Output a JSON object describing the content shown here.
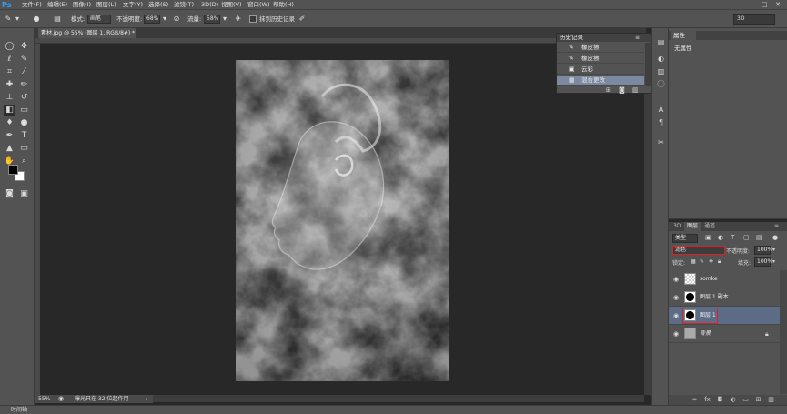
{
  "app": {
    "logo": "Ps"
  },
  "menu": [
    "文件(F)",
    "编辑(E)",
    "图像(I)",
    "图层(L)",
    "文字(Y)",
    "选择(S)",
    "滤镜(T)",
    "3D(D)",
    "视图(V)",
    "窗口(W)",
    "帮助(H)"
  ],
  "options": {
    "mode_label": "模式:",
    "mode_value": "画笔",
    "opacity_label": "不透明度:",
    "opacity_value": "68%",
    "flow_label": "流量:",
    "flow_value": "58%",
    "erase_history_label": "抹到历史记录",
    "workspace": "3D"
  },
  "document": {
    "tab_title": "素材.jpg @ 55% (图层 1, RGB/8#) *",
    "zoom": "55%",
    "status": "曝光只在 32 位起作用"
  },
  "timeline": {
    "label": "时间轴"
  },
  "history": {
    "title": "历史记录",
    "items": [
      {
        "label": "橡皮擦",
        "icon": "eraser-icon",
        "selected": false
      },
      {
        "label": "橡皮擦",
        "icon": "eraser-icon",
        "selected": false
      },
      {
        "label": "云彩",
        "icon": "filter-icon",
        "selected": false
      },
      {
        "label": "混合更改",
        "icon": "layers-icon",
        "selected": true
      }
    ]
  },
  "properties": {
    "title": "属性",
    "empty_text": "无属性"
  },
  "layers": {
    "tabs": [
      "3D",
      "图层",
      "通道"
    ],
    "active_tab": "图层",
    "filter_kind": "类型",
    "blend_mode": "滤色",
    "opacity_label": "不透明度:",
    "opacity_value": "100%",
    "lock_label": "锁定:",
    "fill_label": "填充:",
    "fill_value": "100%",
    "items": [
      {
        "name": "somke",
        "selected": false,
        "locked": false
      },
      {
        "name": "图层 1 副本",
        "selected": false,
        "locked": false
      },
      {
        "name": "图层 1",
        "selected": true,
        "locked": false
      },
      {
        "name": "背景",
        "selected": false,
        "locked": true
      }
    ]
  },
  "colors": {
    "accent": "#2fa3f7",
    "highlight_box": "#e02020",
    "selected_row": "#5d6c86",
    "history_selected": "#7b8aa0"
  }
}
